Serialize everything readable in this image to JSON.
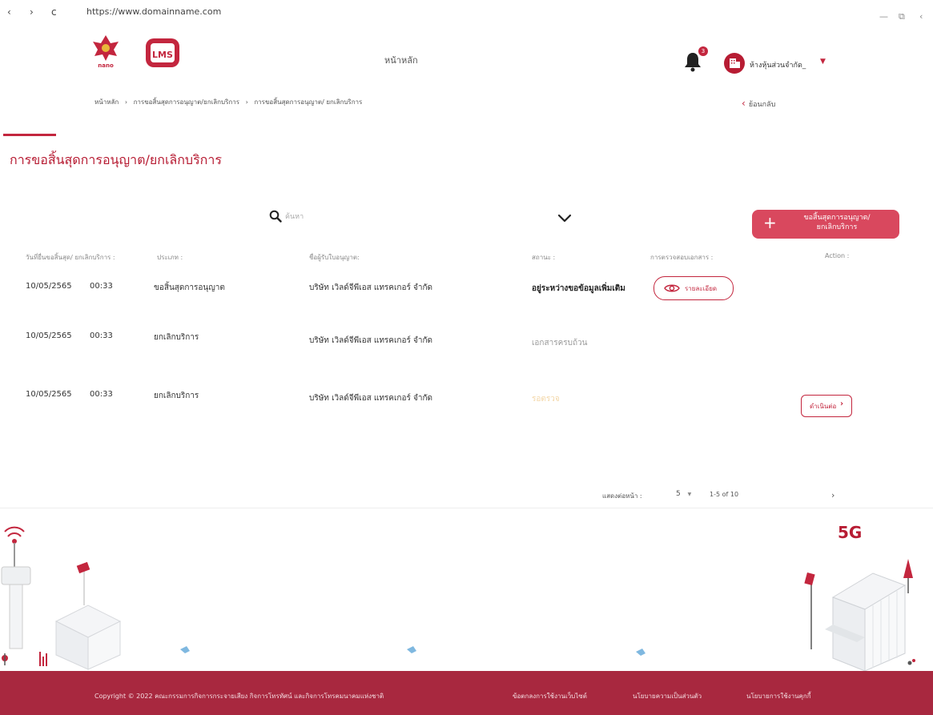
{
  "browser": {
    "url": "https://www.domainname.com",
    "back_glyph": "‹",
    "forward_glyph": "›",
    "reload_glyph": "c",
    "minimize_glyph": "—",
    "restore_glyph": "⧉",
    "close_glyph": "‹"
  },
  "header": {
    "logo_text": "nano",
    "lms_text": "LMS",
    "home_label": "หน้าหลัก",
    "notification_count": "3",
    "org_name": "ห้างหุ้นส่วนจำกัด_"
  },
  "breadcrumb": {
    "items": [
      "หน้าหลัก",
      "การขอสิ้นสุดการอนุญาต/ยกเลิกบริการ",
      "การขอสิ้นสุดการอนุญาต/ ยกเลิกบริการ"
    ],
    "separator": "›"
  },
  "back_label": "ย้อนกลับ",
  "page_title": "การขอสิ้นสุดการอนุญาต/ยกเลิกบริการ",
  "search": {
    "placeholder": "ค้นหา"
  },
  "add_button": {
    "line1": "ขอสิ้นสุดการอนุญาต/",
    "line2": "ยกเลิกบริการ"
  },
  "table": {
    "headers": {
      "date": "วันที่ยื่นขอสิ้นสุด/ ยกเลิกบริการ :",
      "type": "ประเภท :",
      "licensee": "ชื่อผู้รับใบอนุญาต:",
      "status": "สถานะ :",
      "doc_check": "การตรวจสอบเอกสาร :",
      "action": "Action :"
    },
    "rows": [
      {
        "date": "10/05/2565",
        "time": "00:33",
        "type": "ขอสิ้นสุดการอนุญาต",
        "licensee": "บริษัท เวิลด์จีพีเอส แทรคเกอร์ จำกัด",
        "status": "อยู่ระหว่างขอข้อมูลเพิ่มเติม",
        "doc_check": "รายละเอียด"
      },
      {
        "date": "10/05/2565",
        "time": "00:33",
        "type": "ยกเลิกบริการ",
        "licensee": "บริษัท เวิลด์จีพีเอส แทรคเกอร์ จำกัด",
        "status": "เอกสารครบถ้วน"
      },
      {
        "date": "10/05/2565",
        "time": "00:33",
        "type": "ยกเลิกบริการ",
        "licensee": "บริษัท เวิลด์จีพีเอส แทรคเกอร์ จำกัด",
        "status": "รอตรวจ",
        "action": "ดำเนินต่อ"
      }
    ]
  },
  "pagination": {
    "rows_per_page_label": "แสดงต่อหน้า :",
    "rows_per_page": "5",
    "range": "1-5 of 10",
    "next_glyph": "›"
  },
  "illustration": {
    "sign_5g": "5G"
  },
  "footer": {
    "copyright": "Copyright © 2022 คณะกรรมการกิจการกระจายเสียง กิจการโทรทัศน์ และกิจการโทรคมนาคมแห่งชาติ",
    "links": [
      "ข้อตกลงการใช้งานเว็บไซต์",
      "นโยบายความเป็นส่วนตัว",
      "นโยบายการใช้งานคุกกี้"
    ]
  },
  "colors": {
    "brand": "#b71c33",
    "accent": "#d9485e",
    "footer": "#a8283f"
  }
}
